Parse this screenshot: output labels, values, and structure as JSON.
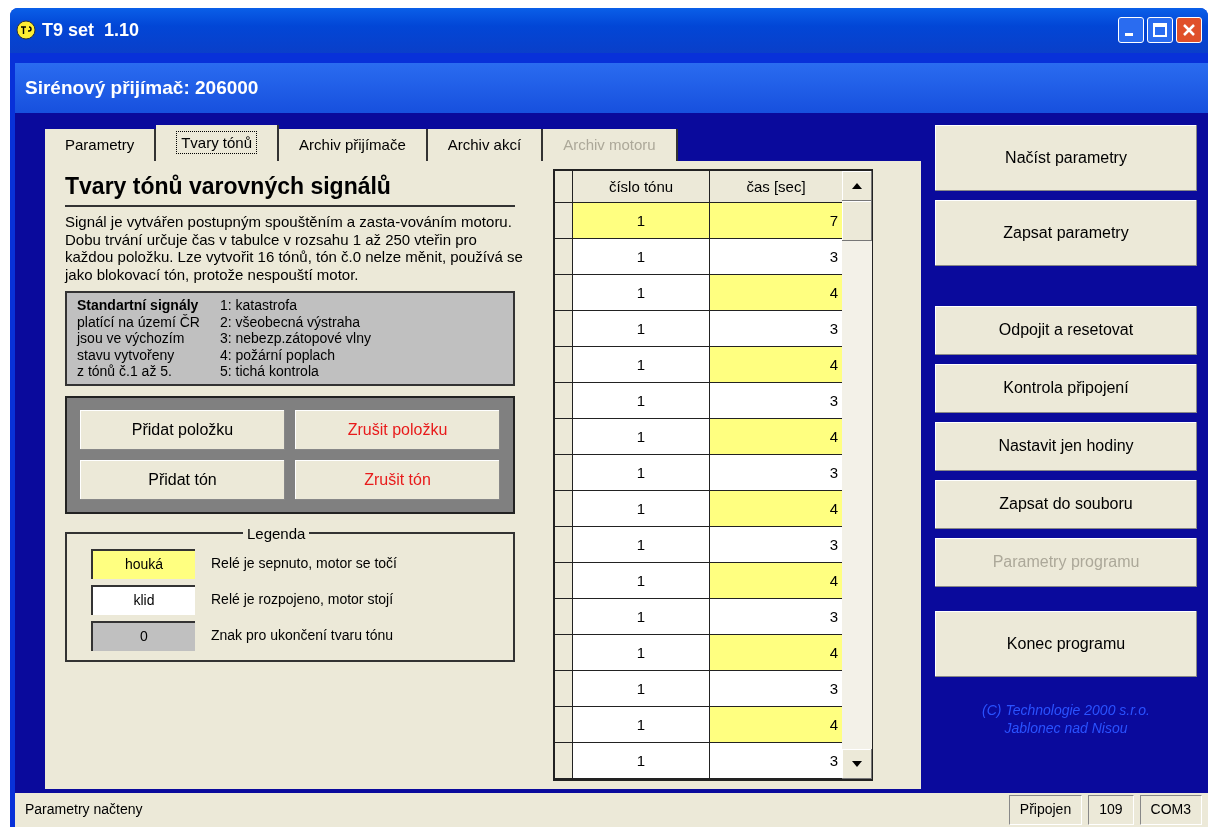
{
  "window": {
    "title": "T9 set  1.10",
    "subtitle": "Sirénový přijímač: 206000"
  },
  "tabs": [
    {
      "label": "Parametry",
      "selected": false,
      "disabled": false
    },
    {
      "label": "Tvary tónů",
      "selected": true,
      "disabled": false
    },
    {
      "label": "Archiv přijímače",
      "selected": false,
      "disabled": false
    },
    {
      "label": "Archiv akcí",
      "selected": false,
      "disabled": false
    },
    {
      "label": "Archiv motoru",
      "selected": false,
      "disabled": true
    }
  ],
  "heading": "Tvary tónů varovných signálů",
  "description": "Signál je vytvářen postupným spouštěním a zasta-vováním motoru. Dobu trvání určuje čas v tabulce v rozsahu 1 až 250 vteřin pro každou položku. Lze vytvořit 16 tónů, tón č.0 nelze měnit, používá se jako blokovací tón, protože nespouští motor.",
  "standard": {
    "title": "Standartní signály",
    "lines": [
      "platící na území ČR",
      "jsou ve výchozím",
      "stavu vytvořeny",
      "z tónů č.1 až 5."
    ],
    "signals": [
      "1: katastrofa",
      "2: všeobecná výstraha",
      "3: nebezp.zátopové vlny",
      "4: požární poplach",
      "5: tichá kontrola"
    ]
  },
  "edit_buttons": [
    {
      "label": "Přidat položku",
      "danger": false
    },
    {
      "label": "Zrušit položku",
      "danger": true
    },
    {
      "label": "Přidat tón",
      "danger": false
    },
    {
      "label": "Zrušit tón",
      "danger": true
    }
  ],
  "legend": {
    "title": "Legenda",
    "items": [
      {
        "kind": "on",
        "sample": "houká",
        "text": "Relé je sepnuto, motor se točí"
      },
      {
        "kind": "off",
        "sample": "klid",
        "text": "Relé je rozpojeno, motor stojí"
      },
      {
        "kind": "end",
        "sample": "0",
        "text": "Znak pro ukončení tvaru tónu"
      }
    ]
  },
  "table": {
    "columns": [
      "číslo tónu",
      "čas [sec]"
    ],
    "rows": [
      {
        "tone": "1",
        "tone_on": true,
        "time": "7",
        "time_on": true
      },
      {
        "tone": "1",
        "tone_on": false,
        "time": "3",
        "time_on": false
      },
      {
        "tone": "1",
        "tone_on": false,
        "time": "4",
        "time_on": true
      },
      {
        "tone": "1",
        "tone_on": false,
        "time": "3",
        "time_on": false
      },
      {
        "tone": "1",
        "tone_on": false,
        "time": "4",
        "time_on": true
      },
      {
        "tone": "1",
        "tone_on": false,
        "time": "3",
        "time_on": false
      },
      {
        "tone": "1",
        "tone_on": false,
        "time": "4",
        "time_on": true
      },
      {
        "tone": "1",
        "tone_on": false,
        "time": "3",
        "time_on": false
      },
      {
        "tone": "1",
        "tone_on": false,
        "time": "4",
        "time_on": true
      },
      {
        "tone": "1",
        "tone_on": false,
        "time": "3",
        "time_on": false
      },
      {
        "tone": "1",
        "tone_on": false,
        "time": "4",
        "time_on": true
      },
      {
        "tone": "1",
        "tone_on": false,
        "time": "3",
        "time_on": false
      },
      {
        "tone": "1",
        "tone_on": false,
        "time": "4",
        "time_on": true
      },
      {
        "tone": "1",
        "tone_on": false,
        "time": "3",
        "time_on": false
      },
      {
        "tone": "1",
        "tone_on": false,
        "time": "4",
        "time_on": true
      },
      {
        "tone": "1",
        "tone_on": false,
        "time": "3",
        "time_on": false
      }
    ]
  },
  "side_buttons": [
    [
      {
        "label": "Načíst parametry",
        "disabled": false
      },
      {
        "label": "Zapsat parametry",
        "disabled": false
      }
    ],
    [
      {
        "label": "Odpojit a resetovat",
        "disabled": false
      },
      {
        "label": "Kontrola připojení",
        "disabled": false
      },
      {
        "label": "Nastavit jen hodiny",
        "disabled": false
      },
      {
        "label": "Zapsat do souboru",
        "disabled": false
      },
      {
        "label": "Parametry programu",
        "disabled": true
      }
    ],
    [
      {
        "label": "Konec programu",
        "disabled": false
      }
    ]
  ],
  "copyright": [
    "(C) Technologie 2000 s.r.o.",
    "Jablonec nad Nisou"
  ],
  "status_bar": {
    "message": "Parametry načteny",
    "panels": [
      "Připojen",
      "109",
      "COM3"
    ]
  }
}
